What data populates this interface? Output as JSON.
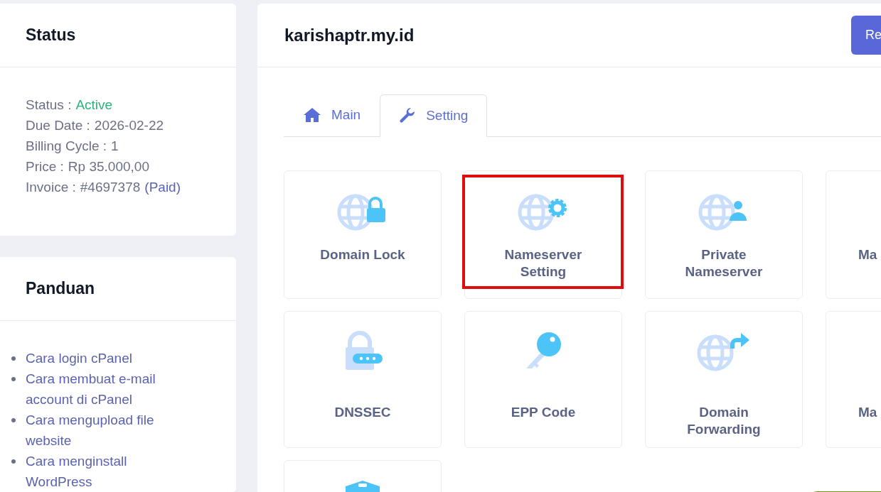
{
  "status_card": {
    "title": "Status",
    "rows": [
      {
        "label": "Status :",
        "value": "Active",
        "kind": "status"
      },
      {
        "label": "Due Date :",
        "value": "2026-02-22",
        "kind": "plain"
      },
      {
        "label": "Billing Cycle :",
        "value": "1",
        "kind": "plain"
      },
      {
        "label": "Price :",
        "value": "Rp 35.000,00",
        "kind": "plain"
      },
      {
        "label": "Invoice :",
        "value": "#4697378",
        "link": "(Paid)",
        "kind": "invoice"
      }
    ]
  },
  "guide_card": {
    "title": "Panduan",
    "links": [
      "Cara login cPanel",
      "Cara membuat e-mail account di cPanel",
      "Cara mengupload file website",
      "Cara menginstall WordPress"
    ]
  },
  "domain": {
    "title": "karishaptr.my.id",
    "button": "Re"
  },
  "tabs": [
    {
      "label": "Main",
      "kind": "home",
      "selected": false
    },
    {
      "label": "Setting",
      "kind": "wrench",
      "selected": true
    }
  ],
  "tiles": [
    {
      "label": "Domain Lock",
      "kind": "lock",
      "highlighted": false
    },
    {
      "label": "Nameserver Setting",
      "kind": "gear",
      "highlighted": true
    },
    {
      "label": "Private Nameserver",
      "kind": "person",
      "highlighted": false
    },
    {
      "label": "Ma",
      "kind": "cut",
      "highlighted": false
    },
    {
      "label": "DNSSEC",
      "kind": "dnssec",
      "highlighted": false
    },
    {
      "label": "EPP Code",
      "kind": "key",
      "highlighted": false
    },
    {
      "label": "Domain Forwarding",
      "kind": "forward",
      "highlighted": false
    },
    {
      "label": "Ma",
      "kind": "cut",
      "highlighted": false
    },
    {
      "kind": "shield",
      "highlighted": false
    }
  ]
}
